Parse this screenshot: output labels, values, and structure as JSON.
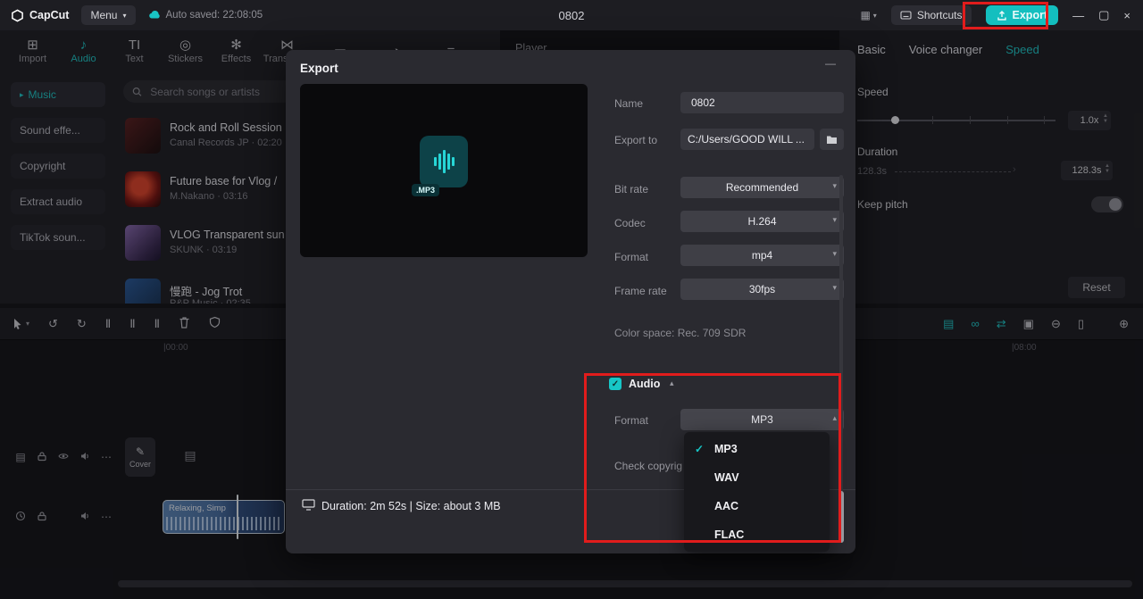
{
  "icons": {
    "menu_caret": "▾",
    "layout_grid": "▦",
    "minimize": "—",
    "maximize": "▢",
    "close": "×",
    "import": "⊞",
    "audio": "♪",
    "text": "TI",
    "stickers": "◎",
    "effects": "✻",
    "transitions": "⋈",
    "captions": "▭",
    "filters": "◑",
    "adjust": "≡",
    "chevron_right": "▸",
    "undo": "↺",
    "redo": "↻",
    "split": "Ⅱ",
    "ellipsis": "⋯",
    "magnet": "∩",
    "link": "∞",
    "snap": "⇄",
    "grid": "▣",
    "zoom_out": "⊖",
    "zoom_in": "⊕",
    "marker": "▯",
    "caret_down": "▾",
    "caret_up": "▴",
    "check": "✓",
    "track_options": "▤",
    "main_track": "▤",
    "pencil": "✎"
  },
  "topbar": {
    "logo_text": "CapCut",
    "menu_label": "Menu",
    "autosave_text": "Auto saved: 22:08:05",
    "doc_title": "0802",
    "shortcuts_label": "Shortcuts",
    "export_label": "Export"
  },
  "ribbon": {
    "tabs": [
      {
        "label": "Import"
      },
      {
        "label": "Audio"
      },
      {
        "label": "Text"
      },
      {
        "label": "Stickers"
      },
      {
        "label": "Effects"
      },
      {
        "label": "Transitions"
      }
    ],
    "active_tab": "Audio"
  },
  "sidebar": {
    "items": [
      "Music",
      "Sound effe...",
      "Copyright",
      "Extract audio",
      "TikTok soun..."
    ],
    "active_item": "Music"
  },
  "library": {
    "search_placeholder": "Search songs or artists",
    "tracks": [
      {
        "title": "Rock and Roll Session",
        "meta": "Canal Records JP · 02:20"
      },
      {
        "title": "Future base for Vlog /",
        "meta": "M.Nakano · 03:16"
      },
      {
        "title": "VLOG Transparent sun",
        "meta": "SKUNK · 03:19"
      },
      {
        "title": "慢跑 - Jog Trot",
        "meta": "P&P Music · 02:35"
      }
    ]
  },
  "player": {
    "title": "Player"
  },
  "inspector": {
    "tabs": [
      "Basic",
      "Voice changer",
      "Speed"
    ],
    "active_tab": "Speed",
    "speed_label": "Speed",
    "speed_value": "1.0x",
    "duration_label": "Duration",
    "duration_current": "128.3s",
    "duration_value": "128.3s",
    "keep_pitch_label": "Keep pitch",
    "reset_label": "Reset"
  },
  "export_dialog": {
    "title": "Export",
    "preview_badge": ".MP3",
    "name": {
      "label": "Name",
      "value": "0802"
    },
    "export_to": {
      "label": "Export to",
      "value": "C:/Users/GOOD WILL ..."
    },
    "bit_rate": {
      "label": "Bit rate",
      "value": "Recommended"
    },
    "codec": {
      "label": "Codec",
      "value": "H.264"
    },
    "format": {
      "label": "Format",
      "value": "mp4"
    },
    "frame_rate": {
      "label": "Frame rate",
      "value": "30fps"
    },
    "color_space_text": "Color space: Rec. 709 SDR",
    "audio": {
      "section_label": "Audio",
      "format_label": "Format",
      "format_value": "MP3",
      "options": [
        "MP3",
        "WAV",
        "AAC",
        "FLAC"
      ],
      "selected_option": "MP3"
    },
    "check_copyright_label": "Check copyrig",
    "footer_text": "Duration: 2m 52s | Size: about 3 MB"
  },
  "timeline": {
    "ruler_start": "|00:00",
    "ruler_end": "|08:00",
    "cover_label": "Cover",
    "clip_title": "Relaxing, Simp"
  },
  "colors": {
    "accent": "#1fc8c8",
    "highlight_red": "#e11c1c"
  }
}
